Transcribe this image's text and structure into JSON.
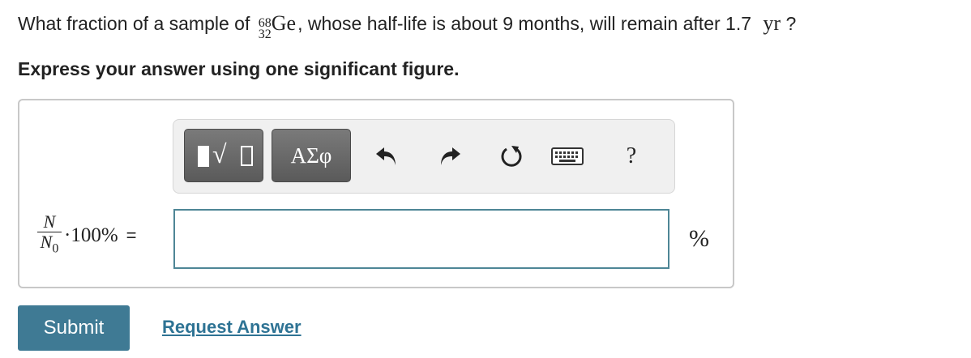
{
  "question": {
    "prefix": "What fraction of a sample of",
    "isotope_mass": "68",
    "isotope_atomic": "32",
    "isotope_symbol": "Ge",
    "suffix": ", whose half-life is about 9 months, will remain after 1.7",
    "unit": "yr",
    "end": "?"
  },
  "instruction": "Express your answer using one significant figure.",
  "toolbar": {
    "symbols_label": "ΑΣφ",
    "help_label": "?",
    "icons": [
      "templates-icon",
      "undo-icon",
      "redo-icon",
      "reset-icon",
      "keyboard-icon",
      "help-icon"
    ]
  },
  "expression": {
    "numerator": "N",
    "denominator": "N",
    "denominator_sub": "0",
    "factor": "·100%",
    "equals": "="
  },
  "answer": {
    "value": "",
    "unit": "%"
  },
  "actions": {
    "submit_label": "Submit",
    "request_label": "Request Answer"
  },
  "colors": {
    "submit_bg": "#3f7a94",
    "link": "#2e7394",
    "input_border": "#4e8696"
  }
}
